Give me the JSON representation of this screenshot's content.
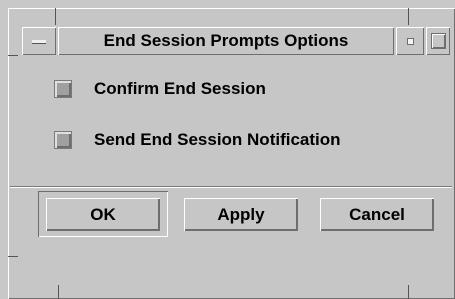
{
  "window": {
    "title": "End Session Prompts Options"
  },
  "options": [
    {
      "label": "Confirm End Session",
      "checked": false
    },
    {
      "label": "Send End Session Notification",
      "checked": false
    }
  ],
  "buttons": {
    "ok_label": "OK",
    "apply_label": "Apply",
    "cancel_label": "Cancel"
  }
}
